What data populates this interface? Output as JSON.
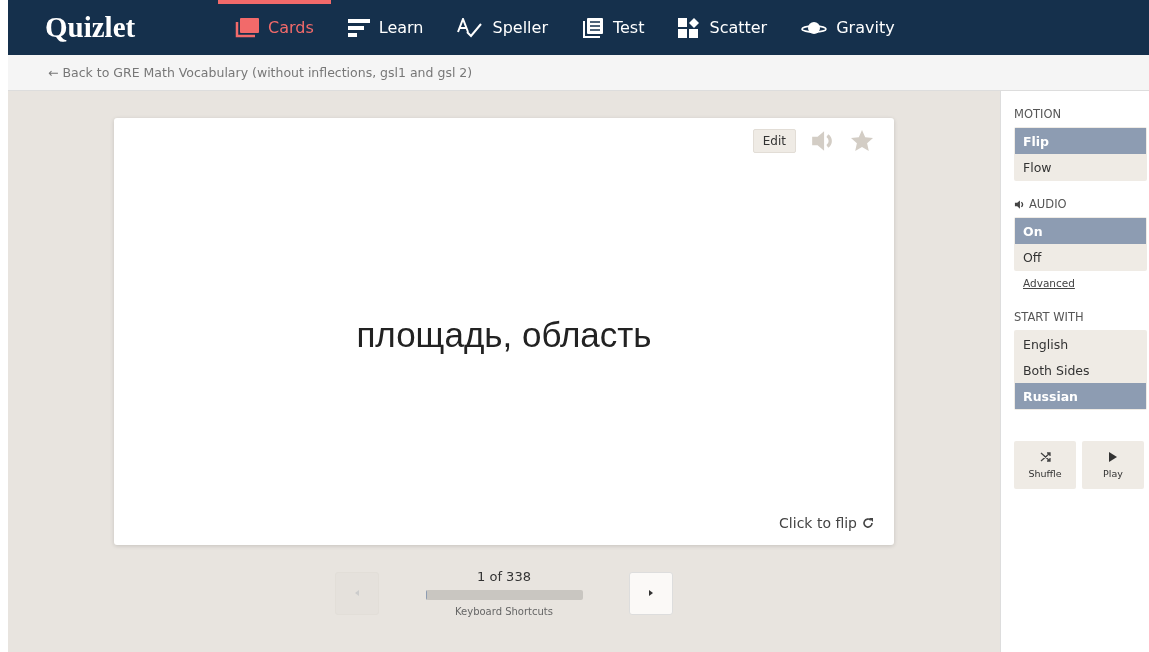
{
  "logo": "Quizlet",
  "nav": [
    {
      "label": "Cards",
      "selected": true
    },
    {
      "label": "Learn",
      "selected": false
    },
    {
      "label": "Speller",
      "selected": false
    },
    {
      "label": "Test",
      "selected": false
    },
    {
      "label": "Scatter",
      "selected": false
    },
    {
      "label": "Gravity",
      "selected": false
    }
  ],
  "back_link": "← Back to GRE Math Vocabulary (without inflections, gsl1 and gsl 2)",
  "card": {
    "edit": "Edit",
    "starred": false,
    "term": "площадь, область",
    "flip_hint": "Click to flip"
  },
  "pager": {
    "counter": "1 of 338",
    "level": 0.003,
    "shortcuts": "Keyboard Shortcuts",
    "prev_disabled": true,
    "next_disabled": false
  },
  "sidebar": {
    "sections": [
      {
        "heading": "MOTION",
        "kind": "plain",
        "options": [
          {
            "label": "Flip",
            "selected": true
          },
          {
            "label": "Flow",
            "selected": false
          }
        ]
      },
      {
        "heading": "AUDIO",
        "kind": "audio",
        "options": [
          {
            "label": "On",
            "selected": true
          },
          {
            "label": "Off",
            "selected": false
          }
        ],
        "link": "Advanced"
      },
      {
        "heading": "START WITH",
        "kind": "plain",
        "options": [
          {
            "label": "English",
            "selected": false
          },
          {
            "label": "Both Sides",
            "selected": false
          },
          {
            "label": "Russian",
            "selected": true
          }
        ]
      }
    ],
    "actions": [
      {
        "label": "Shuffle"
      },
      {
        "label": "Play"
      }
    ]
  }
}
